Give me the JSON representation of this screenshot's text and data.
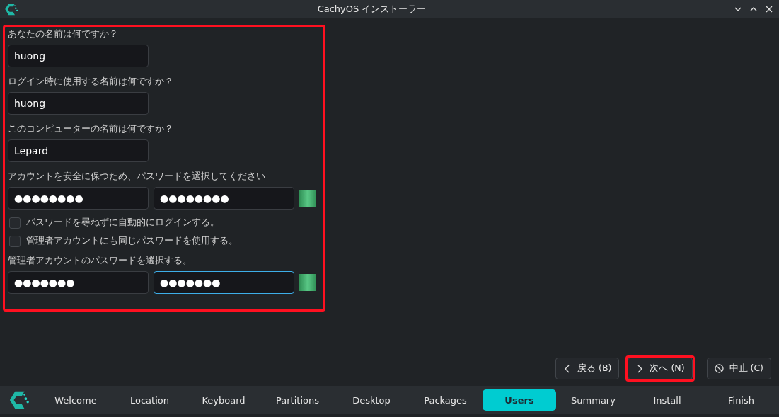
{
  "window": {
    "title": "CachyOS インストーラー"
  },
  "form": {
    "highlighted": true,
    "sections": [
      {
        "kind": "text",
        "label": "あなたの名前は何ですか？",
        "fields": [
          {
            "value": "huong",
            "focused": false
          }
        ]
      },
      {
        "kind": "text",
        "label": "ログイン時に使用する名前は何ですか？",
        "fields": [
          {
            "value": "huong",
            "focused": false
          }
        ]
      },
      {
        "kind": "text",
        "label": "このコンピューターの名前は何ですか？",
        "fields": [
          {
            "value": "Lepard",
            "focused": false
          }
        ]
      },
      {
        "kind": "password",
        "label": "アカウントを安全に保つため、パスワードを選択してください",
        "fields": [
          {
            "value": "●●●●●●●●",
            "focused": false
          },
          {
            "value": "●●●●●●●●",
            "focused": false
          }
        ],
        "level": 1
      },
      {
        "kind": "checkbox",
        "label": "パスワードを尋ねずに自動的にログインする。",
        "checked": false
      },
      {
        "kind": "checkbox",
        "label": "管理者アカウントにも同じパスワードを使用する。",
        "checked": false
      },
      {
        "kind": "password",
        "label": "管理者アカウントのパスワードを選択する。",
        "fields": [
          {
            "value": "●●●●●●●",
            "focused": false
          },
          {
            "value": "●●●●●●●",
            "focused": true
          }
        ],
        "level": 1
      }
    ]
  },
  "buttons": [
    {
      "kind": "back",
      "label": "戻る (B)",
      "highlighted": false
    },
    {
      "kind": "next",
      "label": "次へ (N)",
      "highlighted": true
    },
    {
      "kind": "cancel",
      "label": "中止 (C)",
      "highlighted": false
    }
  ],
  "steps": [
    {
      "label": "Welcome",
      "selected": false
    },
    {
      "label": "Location",
      "selected": false
    },
    {
      "label": "Keyboard",
      "selected": false
    },
    {
      "label": "Partitions",
      "selected": false
    },
    {
      "label": "Desktop",
      "selected": false
    },
    {
      "label": "Packages",
      "selected": false
    },
    {
      "label": "Users",
      "selected": true
    },
    {
      "label": "Summary",
      "selected": false
    },
    {
      "label": "Install",
      "selected": false
    },
    {
      "label": "Finish",
      "selected": false
    }
  ]
}
